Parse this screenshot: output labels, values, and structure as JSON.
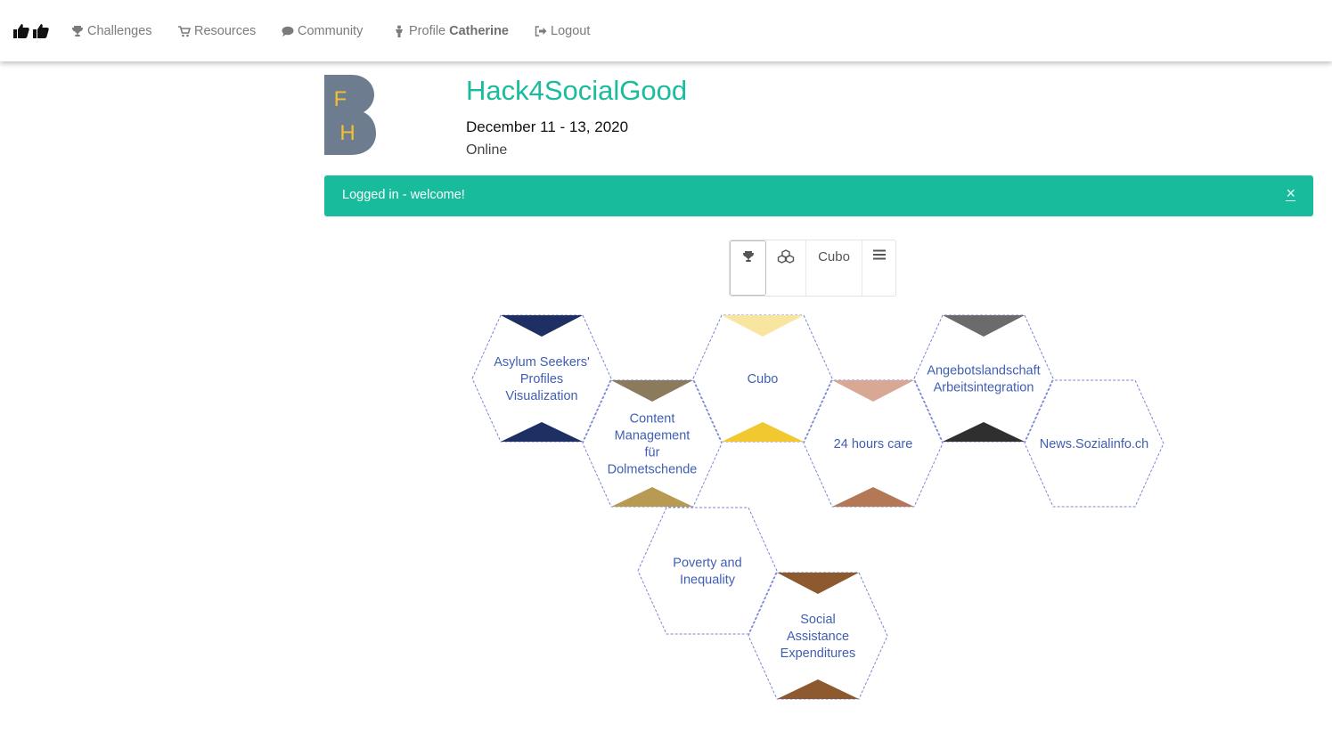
{
  "nav": {
    "items": [
      {
        "label": "Challenges",
        "icon": "trophy-icon"
      },
      {
        "label": "Resources",
        "icon": "cart-icon"
      },
      {
        "label": "Community",
        "icon": "comment-icon"
      },
      {
        "label": "Profile",
        "user": "Catherine",
        "icon": "user-icon"
      },
      {
        "label": "Logout",
        "icon": "logout-icon"
      }
    ]
  },
  "event": {
    "logo_letters": [
      "F",
      "H"
    ],
    "title": "Hack4SocialGood",
    "date": "December 11 - 13, 2020",
    "location": "Online"
  },
  "alert": {
    "message": "Logged in - welcome!",
    "close": "×"
  },
  "view_toggle": {
    "options": [
      "trophy-icon",
      "cubes-icon",
      "Cubo",
      "list-icon"
    ],
    "label": "Cubo",
    "active": 0
  },
  "projects": [
    {
      "lines": [
        "Asylum Seekers'",
        "Profiles",
        "Visualization"
      ],
      "image_colors": [
        "#1d2f63",
        "#1d2f63"
      ]
    },
    {
      "lines": [
        "Content",
        "Management",
        "für",
        "Dolmetschende"
      ],
      "image_colors": [
        "#8c7a5c",
        "#b99a52"
      ]
    },
    {
      "lines": [
        "Cubo"
      ],
      "image_colors": [
        "#f8e6a0",
        "#f2c831"
      ]
    },
    {
      "lines": [
        "24 hours care"
      ],
      "image_colors": [
        "#d9a894",
        "#b57856"
      ]
    },
    {
      "lines": [
        "Angebotslandschaft",
        "Arbeitsintegration"
      ],
      "image_colors": [
        "#6b6b6b",
        "#2f2f2f"
      ]
    },
    {
      "lines": [
        "News.Sozialinfo.ch"
      ],
      "image_colors": []
    },
    {
      "lines": [
        "Poverty and",
        "Inequality"
      ],
      "image_colors": []
    },
    {
      "lines": [
        "Social",
        "Assistance",
        "Expenditures"
      ],
      "image_colors": [
        "#8d5a2f",
        "#8d5a2f"
      ]
    }
  ],
  "colors": {
    "accent": "#18bc9c",
    "title": "#1abc9c",
    "hex_border": "#7a86d6",
    "hex_text": "#3f5fb3",
    "logo": "#6d7d8f",
    "logo_letters": "#f2c12e"
  }
}
